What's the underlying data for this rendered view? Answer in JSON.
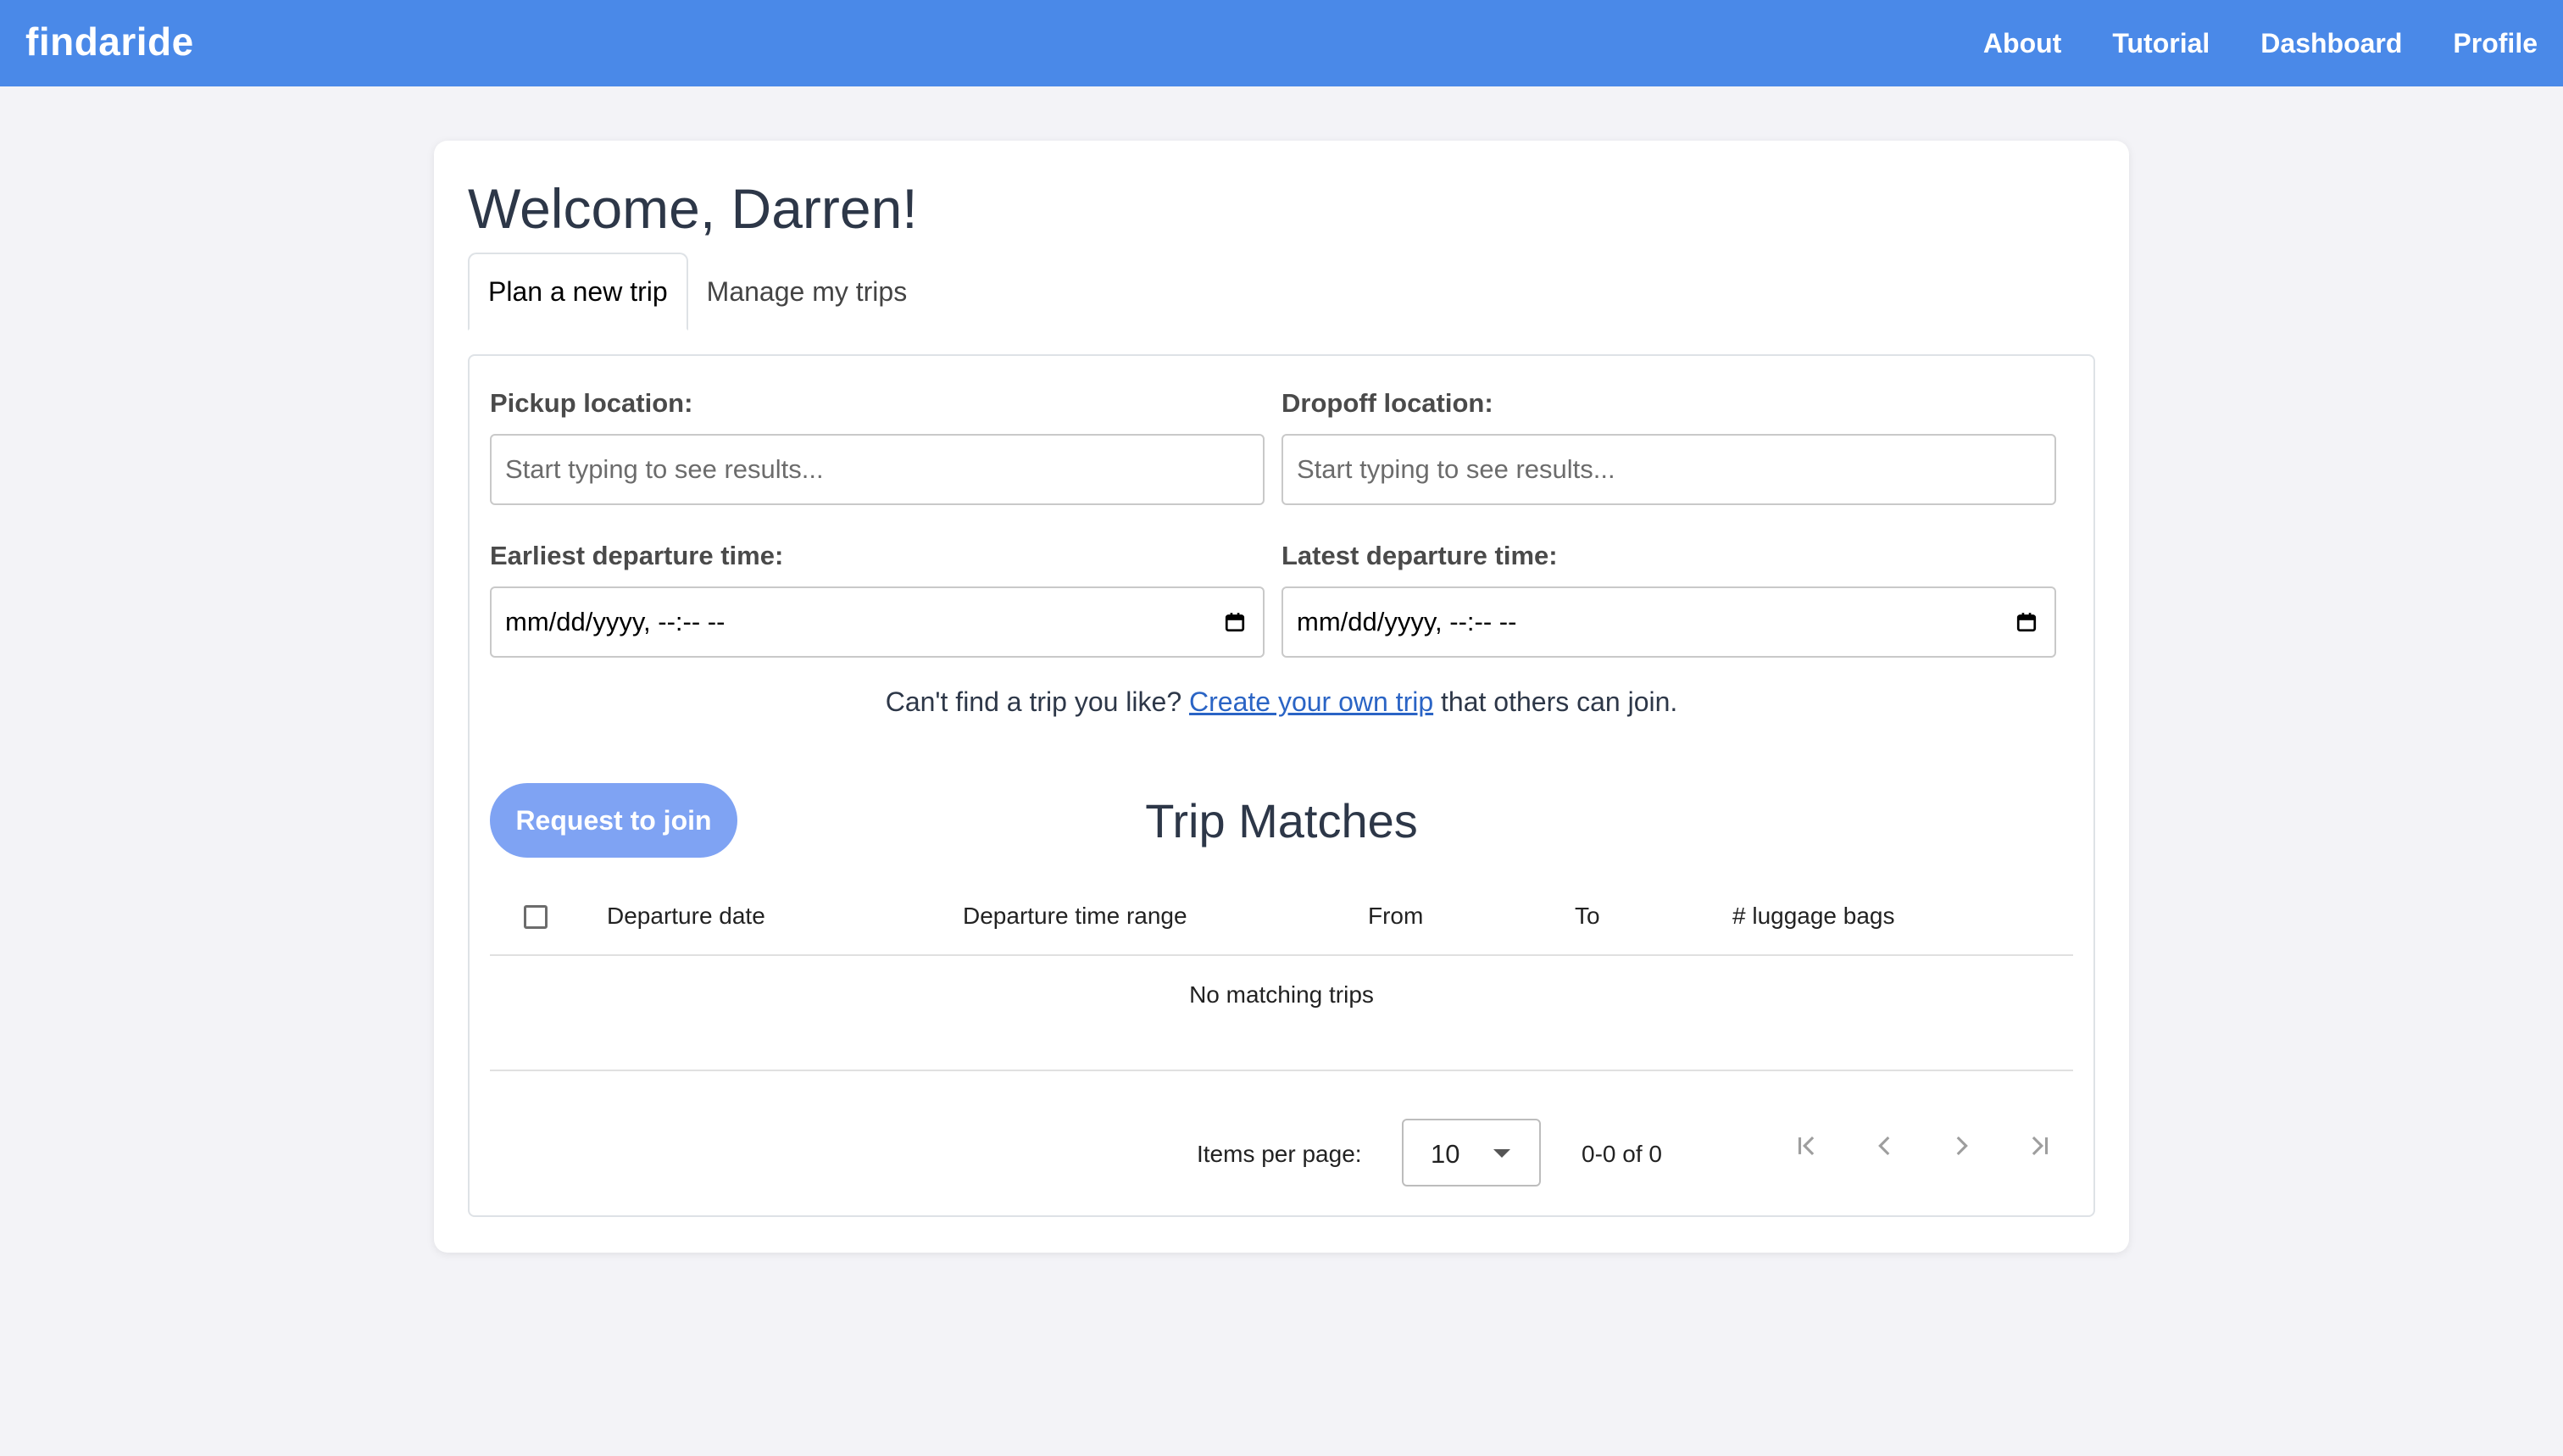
{
  "navbar": {
    "brand": "findaride",
    "links": [
      "About",
      "Tutorial",
      "Dashboard",
      "Profile"
    ]
  },
  "main": {
    "welcome": "Welcome, Darren!",
    "tabs": [
      {
        "label": "Plan a new trip",
        "active": true
      },
      {
        "label": "Manage my trips",
        "active": false
      }
    ],
    "form": {
      "pickup_label": "Pickup location:",
      "pickup_placeholder": "Start typing to see results...",
      "dropoff_label": "Dropoff location:",
      "dropoff_placeholder": "Start typing to see results...",
      "earliest_label": "Earliest departure time:",
      "earliest_value": "mm/dd/yyyy, --:-- --",
      "latest_label": "Latest departure time:",
      "latest_value": "mm/dd/yyyy, --:-- --"
    },
    "create": {
      "prefix": "Can't find a trip you like?",
      "link": "Create your own trip",
      "suffix": "that others can join."
    },
    "request_button": "Request to join",
    "matches_title": "Trip Matches",
    "table": {
      "columns": [
        "Departure date",
        "Departure time range",
        "From",
        "To",
        "# luggage bags"
      ],
      "empty_text": "No matching trips"
    },
    "paginator": {
      "items_per_page_label": "Items per page:",
      "items_per_page_value": "10",
      "range_label": "0-0 of 0"
    }
  },
  "colors": {
    "navbar": "#4a89e8",
    "request_button": "#7fa3f3",
    "link": "#2a64c5",
    "background": "#f3f3f7"
  },
  "icons": [
    "calendar-icon",
    "chevron-down-icon",
    "first-page-icon",
    "previous-page-icon",
    "next-page-icon",
    "last-page-icon"
  ]
}
